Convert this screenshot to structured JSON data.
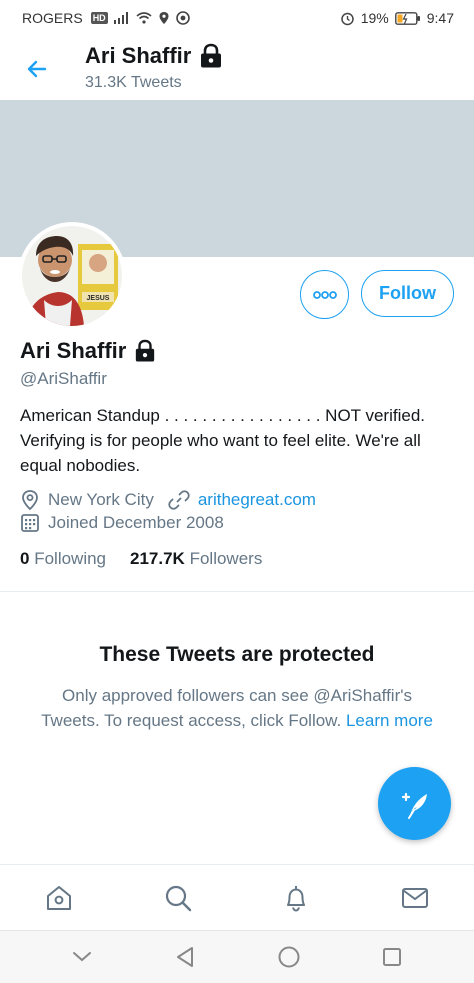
{
  "status_bar": {
    "carrier": "ROGERS",
    "network_badge": "HD",
    "battery_percent": "19%",
    "time": "9:47",
    "icons": [
      "signal-icon",
      "wifi-icon",
      "location-icon",
      "chrome-icon",
      "alarm-icon",
      "battery-icon"
    ]
  },
  "header": {
    "title": "Ari Shaffir",
    "subtitle": "31.3K Tweets",
    "back_icon": "back-arrow-icon",
    "lock_icon": "lock-icon"
  },
  "profile": {
    "name": "Ari Shaffir",
    "handle": "@AriShaffir",
    "bio": "American Standup . . . . . . . . . . . . . . . . . NOT verified. Verifying is for people who want to feel elite. We're all equal nobodies.",
    "location": "New York City",
    "website": "arithegreat.com",
    "joined": "Joined December 2008",
    "following_count": "0",
    "following_label": "Following",
    "followers_count": "217.7K",
    "followers_label": "Followers",
    "avatar_book_label": "JESUS"
  },
  "actions": {
    "follow_label": "Follow",
    "more_icon": "more-options-icon"
  },
  "protected": {
    "title": "These Tweets are protected",
    "message": "Only approved followers can see @AriShaffir's Tweets. To request access, click Follow.",
    "learn_more": "Learn more"
  },
  "tabs": [
    {
      "name": "home",
      "icon": "home-icon"
    },
    {
      "name": "search",
      "icon": "search-icon"
    },
    {
      "name": "notifications",
      "icon": "bell-icon"
    },
    {
      "name": "messages",
      "icon": "mail-icon"
    }
  ],
  "colors": {
    "accent": "#1da1f2",
    "link": "#1b95e0",
    "secondary_text": "#657786",
    "banner": "#ccd6dd"
  }
}
